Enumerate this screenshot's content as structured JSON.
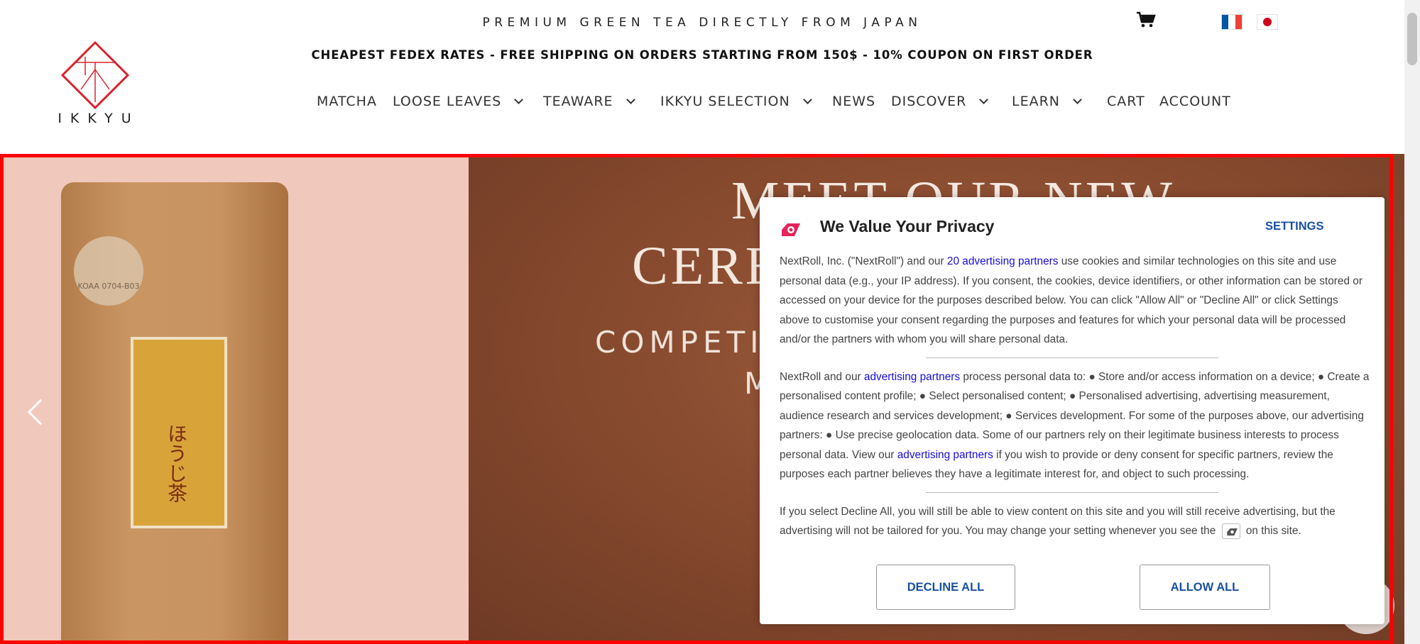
{
  "header": {
    "tagline": "PREMIUM GREEN TEA DIRECTLY FROM JAPAN",
    "shipping_banner": "CHEAPEST FEDEX RATES - FREE SHIPPING ON ORDERS STARTING FROM 150$ - 10% COUPON ON FIRST ORDER",
    "logo_text": "IKKYU",
    "icons": {
      "cart": "cart-icon",
      "flag_fr": "france-flag-icon",
      "flag_jp": "japan-flag-icon"
    }
  },
  "nav": {
    "matcha": "MATCHA",
    "loose_leaves": "LOOSE LEAVES",
    "teaware": "TEAWARE",
    "ikkyu_selection": "IKKYU SELECTION",
    "news": "NEWS",
    "discover": "DISCOVER",
    "learn": "LEARN",
    "cart": "CART",
    "account": "ACCOUNT"
  },
  "hero": {
    "title_line1": "MEET OUR NEW",
    "title_line2": "CERE",
    "subtitle_line1": "COMPETI",
    "subtitle_line2": "M",
    "bag_seal_text": "KOAA 0704-B03",
    "bag_label_text": "ほうじ茶"
  },
  "privacy": {
    "title": "We Value Your Privacy",
    "settings_label": "SETTINGS",
    "p1_a": "NextRoll, Inc. (\"NextRoll\") and our ",
    "p1_link": "20 advertising partners",
    "p1_b": " use cookies and similar technologies on this site and use personal data (e.g., your IP address). If you consent, the cookies, device identifiers, or other information can be stored or accessed on your device for the purposes described below. You can click \"Allow All\" or \"Decline All\" or click Settings above to customise your consent regarding the purposes and features for which your personal data will be processed and/or the partners with whom you will share personal data.",
    "p2_a": "NextRoll and our ",
    "p2_link1": "advertising partners",
    "p2_b": " process personal data to: ● Store and/or access information on a device; ● Create a personalised content profile; ● Select personalised content; ● Personalised advertising, advertising measurement, audience research and services development; ● Services development. For some of the purposes above, our advertising partners: ● Use precise geolocation data. Some of our partners rely on their legitimate business interests to process personal data. View our ",
    "p2_link2": "advertising partners",
    "p2_c": " if you wish to provide or deny consent for specific partners, review the purposes each partner believes they have a legitimate interest for, and object to such processing.",
    "p3_a": "If you select Decline All, you will still be able to view content on this site and you will still receive advertising, but the advertising will not be tailored for you. You may change your setting whenever you see the ",
    "p3_b": " on this site.",
    "decline_label": "DECLINE ALL",
    "allow_label": "ALLOW ALL"
  },
  "colors": {
    "accent_red": "#ff0000",
    "button_text": "#1a4fa0",
    "link": "#1a0dde",
    "logo_red": "#d9232d"
  }
}
